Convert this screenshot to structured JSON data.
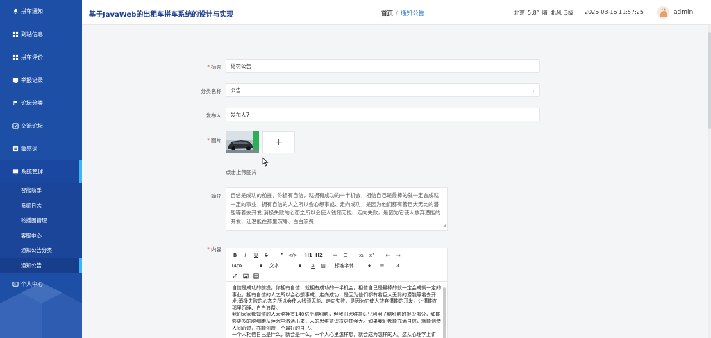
{
  "sidebar": {
    "items": [
      {
        "label": "拼车通知",
        "icon": "bell-icon"
      },
      {
        "label": "到站信息",
        "icon": "grid-icon"
      },
      {
        "label": "拼车评价",
        "icon": "grid-icon"
      },
      {
        "label": "举报记录",
        "icon": "report-icon"
      },
      {
        "label": "论坛分类",
        "icon": "flag-icon"
      },
      {
        "label": "交流论坛",
        "icon": "forum-icon"
      },
      {
        "label": "敏感词",
        "icon": "word-icon"
      },
      {
        "label": "系统管理",
        "icon": "monitor-icon"
      }
    ],
    "sub_items": [
      "智能助手",
      "系统日志",
      "轮播图管理",
      "客服中心",
      "通知公告分类",
      "通知公告"
    ],
    "personal": {
      "label": "个人中心",
      "icon": "person-card-icon"
    }
  },
  "header": {
    "app_title": "基于JavaWeb的出租车拼车系统的设计与实现",
    "breadcrumb_home": "首页",
    "breadcrumb_sep": "/",
    "breadcrumb_current": "通知公告",
    "weather_city": "北京",
    "weather_temp": "5.8°",
    "weather_cond": "晴",
    "weather_wind": "北风",
    "weather_level": "3级",
    "datetime": "2025-03-16 11:57:25",
    "username": "admin"
  },
  "form": {
    "title_label": "标题",
    "title_value": "处罚公告",
    "category_label": "分类名称",
    "category_value": "公告",
    "publisher_label": "发布人",
    "publisher_value": "发布人7",
    "image_label": "图片",
    "upload_plus": "+",
    "upload_hint": "点击上传图片",
    "intro_label": "简介",
    "intro_value": "自信是成功的前提，你拥有自信，就拥有成功的一半机会，相信自己是最棒的就一定会成就一定的事业，拥有自信的人之所以会心想事成、走向成功，是因为他们都有着巨大无比的潜能等着去开发,消极失败的心态之所以会使人钱颈无能、走向失败，是因为它使人放弃潜能的开发，让潜能在那里沉睡、白白浪费",
    "content_label": "内容"
  },
  "editor": {
    "toolbar_row1": [
      "B",
      "I",
      "U",
      "S",
      "❞",
      "</>",
      "H1",
      "H2",
      "≔",
      "☰",
      "x₁",
      "x¹",
      "⇤",
      "⇥"
    ],
    "font_size": "14px",
    "text_style": "文本",
    "font_family": "标准字体",
    "content": [
      "自信是成功的前提，你拥有自信，就拥有成功的一半机会，相信自己是最棒的就一定会成就一定的事业，拥有自信的人之所以会心想事成、走向成功，是因为他们都有着巨大无比的潜能等着去开发,消极失败的心态之所以会使人钱颈无能、走向失败，是因为它使人放弃潜能的开发，让潜能在那里沉睡、白白浪费。",
      "我们大家都知道的人大脑拥有140亿个脑细胞，但我们思维意识只利用了脑细胞的很少部分，如能够更多的脑细胞从睡眠中激活出来，人的思维意识将更加强大。如果我们都能充满自信，就能创造人间奇迹，亦能创造一个最好的自己。",
      "一个人相信自己是什么，就会是什么，一个人心里怎样想，就会成为怎样的人。这从心理学上讲"
    ]
  },
  "colors": {
    "sidebar_bg": "#1d4fa6",
    "accent": "#3fb4f5",
    "title_color": "#1d3f8f",
    "link_color": "#1d6fd8",
    "required": "#e74c3c"
  }
}
